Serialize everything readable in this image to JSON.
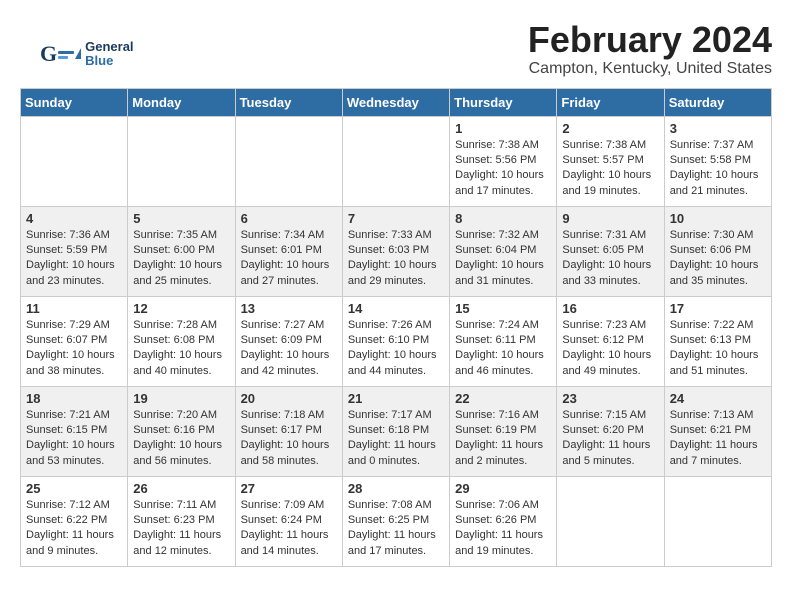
{
  "header": {
    "title": "February 2024",
    "location": "Campton, Kentucky, United States",
    "logo": "GeneralBlue"
  },
  "weekdays": [
    "Sunday",
    "Monday",
    "Tuesday",
    "Wednesday",
    "Thursday",
    "Friday",
    "Saturday"
  ],
  "weeks": [
    [
      {
        "day": "",
        "info": ""
      },
      {
        "day": "",
        "info": ""
      },
      {
        "day": "",
        "info": ""
      },
      {
        "day": "",
        "info": ""
      },
      {
        "day": "1",
        "info": "Sunrise: 7:38 AM\nSunset: 5:56 PM\nDaylight: 10 hours\nand 17 minutes."
      },
      {
        "day": "2",
        "info": "Sunrise: 7:38 AM\nSunset: 5:57 PM\nDaylight: 10 hours\nand 19 minutes."
      },
      {
        "day": "3",
        "info": "Sunrise: 7:37 AM\nSunset: 5:58 PM\nDaylight: 10 hours\nand 21 minutes."
      }
    ],
    [
      {
        "day": "4",
        "info": "Sunrise: 7:36 AM\nSunset: 5:59 PM\nDaylight: 10 hours\nand 23 minutes."
      },
      {
        "day": "5",
        "info": "Sunrise: 7:35 AM\nSunset: 6:00 PM\nDaylight: 10 hours\nand 25 minutes."
      },
      {
        "day": "6",
        "info": "Sunrise: 7:34 AM\nSunset: 6:01 PM\nDaylight: 10 hours\nand 27 minutes."
      },
      {
        "day": "7",
        "info": "Sunrise: 7:33 AM\nSunset: 6:03 PM\nDaylight: 10 hours\nand 29 minutes."
      },
      {
        "day": "8",
        "info": "Sunrise: 7:32 AM\nSunset: 6:04 PM\nDaylight: 10 hours\nand 31 minutes."
      },
      {
        "day": "9",
        "info": "Sunrise: 7:31 AM\nSunset: 6:05 PM\nDaylight: 10 hours\nand 33 minutes."
      },
      {
        "day": "10",
        "info": "Sunrise: 7:30 AM\nSunset: 6:06 PM\nDaylight: 10 hours\nand 35 minutes."
      }
    ],
    [
      {
        "day": "11",
        "info": "Sunrise: 7:29 AM\nSunset: 6:07 PM\nDaylight: 10 hours\nand 38 minutes."
      },
      {
        "day": "12",
        "info": "Sunrise: 7:28 AM\nSunset: 6:08 PM\nDaylight: 10 hours\nand 40 minutes."
      },
      {
        "day": "13",
        "info": "Sunrise: 7:27 AM\nSunset: 6:09 PM\nDaylight: 10 hours\nand 42 minutes."
      },
      {
        "day": "14",
        "info": "Sunrise: 7:26 AM\nSunset: 6:10 PM\nDaylight: 10 hours\nand 44 minutes."
      },
      {
        "day": "15",
        "info": "Sunrise: 7:24 AM\nSunset: 6:11 PM\nDaylight: 10 hours\nand 46 minutes."
      },
      {
        "day": "16",
        "info": "Sunrise: 7:23 AM\nSunset: 6:12 PM\nDaylight: 10 hours\nand 49 minutes."
      },
      {
        "day": "17",
        "info": "Sunrise: 7:22 AM\nSunset: 6:13 PM\nDaylight: 10 hours\nand 51 minutes."
      }
    ],
    [
      {
        "day": "18",
        "info": "Sunrise: 7:21 AM\nSunset: 6:15 PM\nDaylight: 10 hours\nand 53 minutes."
      },
      {
        "day": "19",
        "info": "Sunrise: 7:20 AM\nSunset: 6:16 PM\nDaylight: 10 hours\nand 56 minutes."
      },
      {
        "day": "20",
        "info": "Sunrise: 7:18 AM\nSunset: 6:17 PM\nDaylight: 10 hours\nand 58 minutes."
      },
      {
        "day": "21",
        "info": "Sunrise: 7:17 AM\nSunset: 6:18 PM\nDaylight: 11 hours\nand 0 minutes."
      },
      {
        "day": "22",
        "info": "Sunrise: 7:16 AM\nSunset: 6:19 PM\nDaylight: 11 hours\nand 2 minutes."
      },
      {
        "day": "23",
        "info": "Sunrise: 7:15 AM\nSunset: 6:20 PM\nDaylight: 11 hours\nand 5 minutes."
      },
      {
        "day": "24",
        "info": "Sunrise: 7:13 AM\nSunset: 6:21 PM\nDaylight: 11 hours\nand 7 minutes."
      }
    ],
    [
      {
        "day": "25",
        "info": "Sunrise: 7:12 AM\nSunset: 6:22 PM\nDaylight: 11 hours\nand 9 minutes."
      },
      {
        "day": "26",
        "info": "Sunrise: 7:11 AM\nSunset: 6:23 PM\nDaylight: 11 hours\nand 12 minutes."
      },
      {
        "day": "27",
        "info": "Sunrise: 7:09 AM\nSunset: 6:24 PM\nDaylight: 11 hours\nand 14 minutes."
      },
      {
        "day": "28",
        "info": "Sunrise: 7:08 AM\nSunset: 6:25 PM\nDaylight: 11 hours\nand 17 minutes."
      },
      {
        "day": "29",
        "info": "Sunrise: 7:06 AM\nSunset: 6:26 PM\nDaylight: 11 hours\nand 19 minutes."
      },
      {
        "day": "",
        "info": ""
      },
      {
        "day": "",
        "info": ""
      }
    ]
  ]
}
